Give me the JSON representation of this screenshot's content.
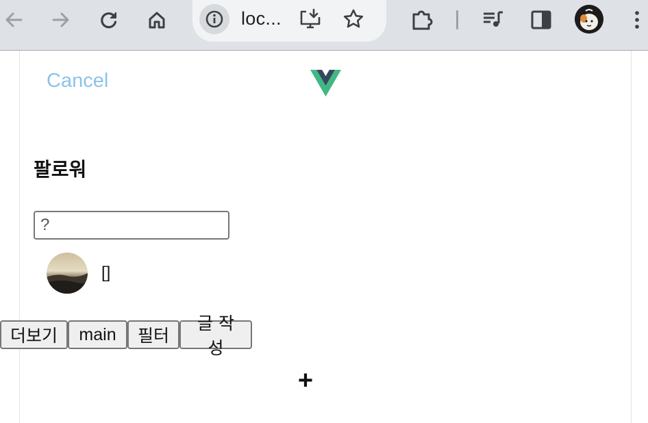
{
  "browser": {
    "url_display": "loc...",
    "icons": [
      "back-arrow-icon",
      "forward-arrow-icon",
      "reload-icon",
      "home-icon",
      "site-info-icon",
      "install-app-icon",
      "bookmark-star-icon",
      "extensions-puzzle-icon",
      "media-queue-icon",
      "side-panel-icon",
      "profile-avatar",
      "more-menu-icon"
    ]
  },
  "header": {
    "cancel_label": "Cancel",
    "logo": "vue-logo"
  },
  "page": {
    "title": "팔로워"
  },
  "search": {
    "placeholder": "?"
  },
  "followers": [
    {
      "name": "[]"
    }
  ],
  "buttons": {
    "more": "더보기",
    "main": "main",
    "filter": "필터",
    "write": "글 작성"
  },
  "fab": {
    "label": "+"
  },
  "colors": {
    "toolbar": "#dee1e6",
    "cancel": "#8cc3e8",
    "vue_green": "#41b883",
    "vue_dark": "#35495e"
  }
}
